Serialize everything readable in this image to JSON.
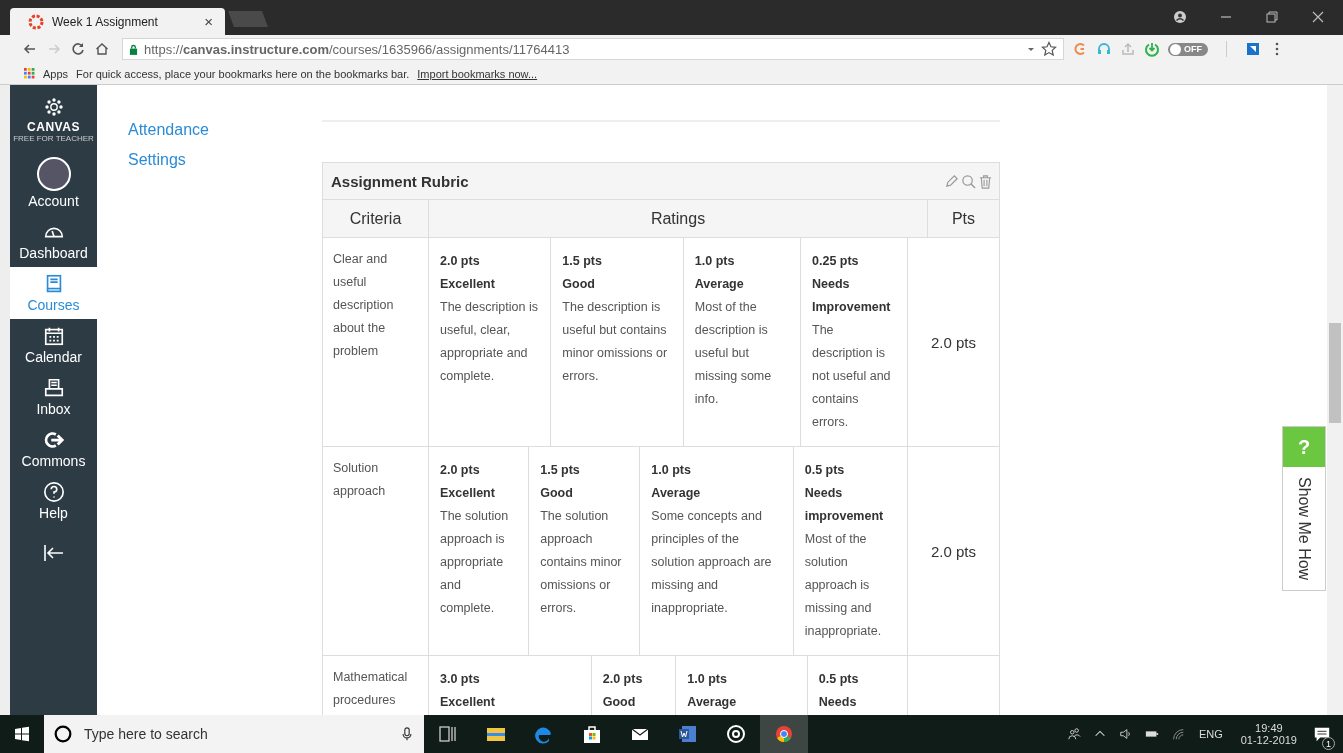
{
  "browser": {
    "tab": {
      "title": "Week 1 Assignment",
      "close": "×"
    },
    "url": "https://**canvas.instructure.com**/courses/1635966/assignments/11764413",
    "toggle_label": "OFF",
    "bookmarks": {
      "apps": "Apps",
      "hint": "For quick access, place your bookmarks here on the bookmarks bar.",
      "link": "Import bookmarks now..."
    }
  },
  "global_nav": {
    "logo": "CANVAS",
    "logo_sub": "FREE FOR TEACHER",
    "items": [
      {
        "kind": "account",
        "label": "Account",
        "selected": false
      },
      {
        "kind": "dashboard",
        "label": "Dashboard",
        "selected": false
      },
      {
        "kind": "courses",
        "label": "Courses",
        "selected": true
      },
      {
        "kind": "calendar",
        "label": "Calendar",
        "selected": false
      },
      {
        "kind": "inbox",
        "label": "Inbox",
        "selected": false
      },
      {
        "kind": "commons",
        "label": "Commons",
        "selected": false
      },
      {
        "kind": "help",
        "label": "Help",
        "selected": false
      }
    ]
  },
  "course_nav": [
    "Attendance",
    "Settings"
  ],
  "rubric": {
    "title": "Assignment Rubric",
    "columns": [
      "Criteria",
      "Ratings",
      "Pts"
    ],
    "rows": [
      {
        "criterion": "Clear and useful description about the problem",
        "pts": "2.0 pts",
        "ratings": [
          {
            "points": "2.0 pts",
            "name": "Excellent",
            "description": "The description is useful, clear, appropriate and complete."
          },
          {
            "points": "1.5 pts",
            "name": "Good",
            "description": "The description is useful but contains minor omissions or errors."
          },
          {
            "points": "1.0 pts",
            "name": "Average",
            "description": "Most of the description is useful but missing some info."
          },
          {
            "points": "0.25 pts",
            "name": "Needs Improvement",
            "description": "The description is not useful and contains errors."
          }
        ]
      },
      {
        "criterion": "Solution approach",
        "pts": "2.0 pts",
        "ratings": [
          {
            "points": "2.0 pts",
            "name": "Excellent",
            "description": "The solution approach is appropriate and complete."
          },
          {
            "points": "1.5 pts",
            "name": "Good",
            "description": "The solution approach contains minor omissions or errors."
          },
          {
            "points": "1.0 pts",
            "name": "Average",
            "description": "Some concepts and principles of the solution approach are missing and inappropriate."
          },
          {
            "points": "0.5 pts",
            "name": "Needs improvement",
            "description": "Most of the solution approach is missing and inappropriate."
          }
        ]
      },
      {
        "criterion": "Mathematical procedures",
        "ratings": [
          {
            "points": "3.0 pts",
            "name": "Excellent"
          },
          {
            "points": "2.0 pts",
            "name": "Good"
          },
          {
            "points": "1.0 pts",
            "name": "Average"
          },
          {
            "points": "0.5 pts",
            "name": "Needs"
          }
        ]
      }
    ]
  },
  "help_tab": {
    "icon": "?",
    "label": "Show Me How"
  },
  "taskbar": {
    "search": {
      "placeholder": "Type here to search"
    },
    "apps": [
      {
        "kind": "taskview",
        "selected": false
      },
      {
        "kind": "explorer",
        "selected": false
      },
      {
        "kind": "edge",
        "selected": false
      },
      {
        "kind": "store",
        "selected": false
      },
      {
        "kind": "mail",
        "selected": false
      },
      {
        "kind": "word",
        "selected": false
      },
      {
        "kind": "groove",
        "selected": false
      },
      {
        "kind": "chrome",
        "selected": true
      }
    ],
    "language": "ENG",
    "time": "19:49",
    "date": "01-12-2019",
    "notifications": "1"
  }
}
